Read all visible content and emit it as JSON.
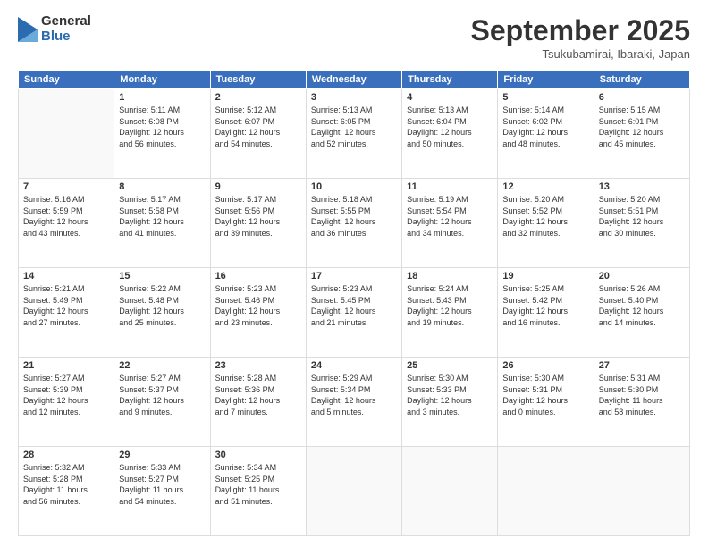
{
  "header": {
    "logo_general": "General",
    "logo_blue": "Blue",
    "title": "September 2025",
    "location": "Tsukubamirai, Ibaraki, Japan"
  },
  "weekdays": [
    "Sunday",
    "Monday",
    "Tuesday",
    "Wednesday",
    "Thursday",
    "Friday",
    "Saturday"
  ],
  "weeks": [
    [
      {
        "day": "",
        "info": ""
      },
      {
        "day": "1",
        "info": "Sunrise: 5:11 AM\nSunset: 6:08 PM\nDaylight: 12 hours\nand 56 minutes."
      },
      {
        "day": "2",
        "info": "Sunrise: 5:12 AM\nSunset: 6:07 PM\nDaylight: 12 hours\nand 54 minutes."
      },
      {
        "day": "3",
        "info": "Sunrise: 5:13 AM\nSunset: 6:05 PM\nDaylight: 12 hours\nand 52 minutes."
      },
      {
        "day": "4",
        "info": "Sunrise: 5:13 AM\nSunset: 6:04 PM\nDaylight: 12 hours\nand 50 minutes."
      },
      {
        "day": "5",
        "info": "Sunrise: 5:14 AM\nSunset: 6:02 PM\nDaylight: 12 hours\nand 48 minutes."
      },
      {
        "day": "6",
        "info": "Sunrise: 5:15 AM\nSunset: 6:01 PM\nDaylight: 12 hours\nand 45 minutes."
      }
    ],
    [
      {
        "day": "7",
        "info": "Sunrise: 5:16 AM\nSunset: 5:59 PM\nDaylight: 12 hours\nand 43 minutes."
      },
      {
        "day": "8",
        "info": "Sunrise: 5:17 AM\nSunset: 5:58 PM\nDaylight: 12 hours\nand 41 minutes."
      },
      {
        "day": "9",
        "info": "Sunrise: 5:17 AM\nSunset: 5:56 PM\nDaylight: 12 hours\nand 39 minutes."
      },
      {
        "day": "10",
        "info": "Sunrise: 5:18 AM\nSunset: 5:55 PM\nDaylight: 12 hours\nand 36 minutes."
      },
      {
        "day": "11",
        "info": "Sunrise: 5:19 AM\nSunset: 5:54 PM\nDaylight: 12 hours\nand 34 minutes."
      },
      {
        "day": "12",
        "info": "Sunrise: 5:20 AM\nSunset: 5:52 PM\nDaylight: 12 hours\nand 32 minutes."
      },
      {
        "day": "13",
        "info": "Sunrise: 5:20 AM\nSunset: 5:51 PM\nDaylight: 12 hours\nand 30 minutes."
      }
    ],
    [
      {
        "day": "14",
        "info": "Sunrise: 5:21 AM\nSunset: 5:49 PM\nDaylight: 12 hours\nand 27 minutes."
      },
      {
        "day": "15",
        "info": "Sunrise: 5:22 AM\nSunset: 5:48 PM\nDaylight: 12 hours\nand 25 minutes."
      },
      {
        "day": "16",
        "info": "Sunrise: 5:23 AM\nSunset: 5:46 PM\nDaylight: 12 hours\nand 23 minutes."
      },
      {
        "day": "17",
        "info": "Sunrise: 5:23 AM\nSunset: 5:45 PM\nDaylight: 12 hours\nand 21 minutes."
      },
      {
        "day": "18",
        "info": "Sunrise: 5:24 AM\nSunset: 5:43 PM\nDaylight: 12 hours\nand 19 minutes."
      },
      {
        "day": "19",
        "info": "Sunrise: 5:25 AM\nSunset: 5:42 PM\nDaylight: 12 hours\nand 16 minutes."
      },
      {
        "day": "20",
        "info": "Sunrise: 5:26 AM\nSunset: 5:40 PM\nDaylight: 12 hours\nand 14 minutes."
      }
    ],
    [
      {
        "day": "21",
        "info": "Sunrise: 5:27 AM\nSunset: 5:39 PM\nDaylight: 12 hours\nand 12 minutes."
      },
      {
        "day": "22",
        "info": "Sunrise: 5:27 AM\nSunset: 5:37 PM\nDaylight: 12 hours\nand 9 minutes."
      },
      {
        "day": "23",
        "info": "Sunrise: 5:28 AM\nSunset: 5:36 PM\nDaylight: 12 hours\nand 7 minutes."
      },
      {
        "day": "24",
        "info": "Sunrise: 5:29 AM\nSunset: 5:34 PM\nDaylight: 12 hours\nand 5 minutes."
      },
      {
        "day": "25",
        "info": "Sunrise: 5:30 AM\nSunset: 5:33 PM\nDaylight: 12 hours\nand 3 minutes."
      },
      {
        "day": "26",
        "info": "Sunrise: 5:30 AM\nSunset: 5:31 PM\nDaylight: 12 hours\nand 0 minutes."
      },
      {
        "day": "27",
        "info": "Sunrise: 5:31 AM\nSunset: 5:30 PM\nDaylight: 11 hours\nand 58 minutes."
      }
    ],
    [
      {
        "day": "28",
        "info": "Sunrise: 5:32 AM\nSunset: 5:28 PM\nDaylight: 11 hours\nand 56 minutes."
      },
      {
        "day": "29",
        "info": "Sunrise: 5:33 AM\nSunset: 5:27 PM\nDaylight: 11 hours\nand 54 minutes."
      },
      {
        "day": "30",
        "info": "Sunrise: 5:34 AM\nSunset: 5:25 PM\nDaylight: 11 hours\nand 51 minutes."
      },
      {
        "day": "",
        "info": ""
      },
      {
        "day": "",
        "info": ""
      },
      {
        "day": "",
        "info": ""
      },
      {
        "day": "",
        "info": ""
      }
    ]
  ]
}
